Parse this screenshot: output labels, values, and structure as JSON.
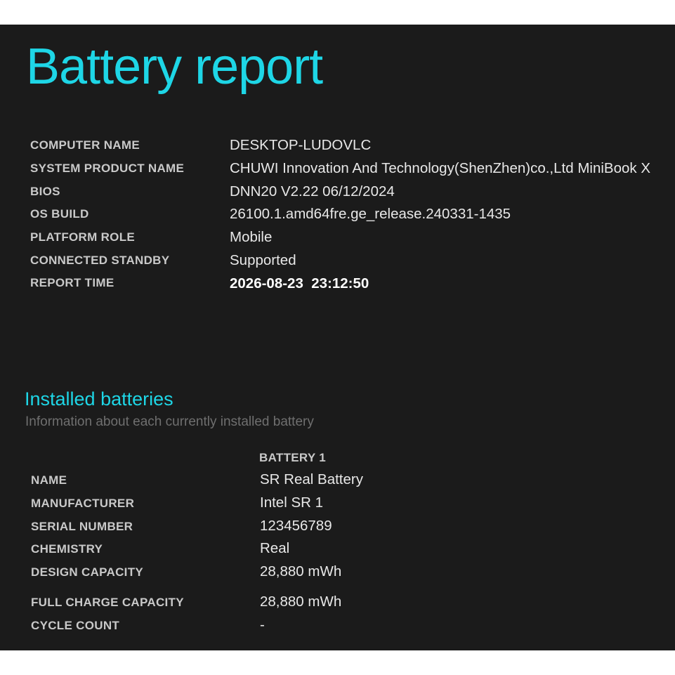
{
  "report_title": "Battery report",
  "system_info": {
    "computer_name_label": "COMPUTER NAME",
    "computer_name": "DESKTOP-LUDOVLC",
    "system_product_name_label": "SYSTEM PRODUCT NAME",
    "system_product_name": "CHUWI Innovation And Technology(ShenZhen)co.,Ltd MiniBook X",
    "bios_label": "BIOS",
    "bios": "DNN20 V2.22 06/12/2024",
    "os_build_label": "OS BUILD",
    "os_build": "26100.1.amd64fre.ge_release.240331-1435",
    "platform_role_label": "PLATFORM ROLE",
    "platform_role": "Mobile",
    "connected_standby_label": "CONNECTED STANDBY",
    "connected_standby": "Supported",
    "report_time_label": "REPORT TIME",
    "report_time": "2026-08-23  23:12:50"
  },
  "installed_batteries": {
    "title": "Installed batteries",
    "subtitle": "Information about each currently installed battery",
    "column_header": "BATTERY 1",
    "name_label": "NAME",
    "name": "SR Real Battery",
    "manufacturer_label": "MANUFACTURER",
    "manufacturer": "Intel SR 1",
    "serial_number_label": "SERIAL NUMBER",
    "serial_number": "123456789",
    "chemistry_label": "CHEMISTRY",
    "chemistry": "Real",
    "design_capacity_label": "DESIGN CAPACITY",
    "design_capacity": "28,880 mWh",
    "full_charge_capacity_label": "FULL CHARGE CAPACITY",
    "full_charge_capacity": "28,880 mWh",
    "cycle_count_label": "CYCLE COUNT",
    "cycle_count": "-"
  },
  "colors": {
    "accent": "#1ed6e6",
    "background": "#1b1b1b",
    "label_text": "#c9c9c9",
    "value_text": "#e8e8e8",
    "subtitle_text": "#6f6f6f"
  }
}
